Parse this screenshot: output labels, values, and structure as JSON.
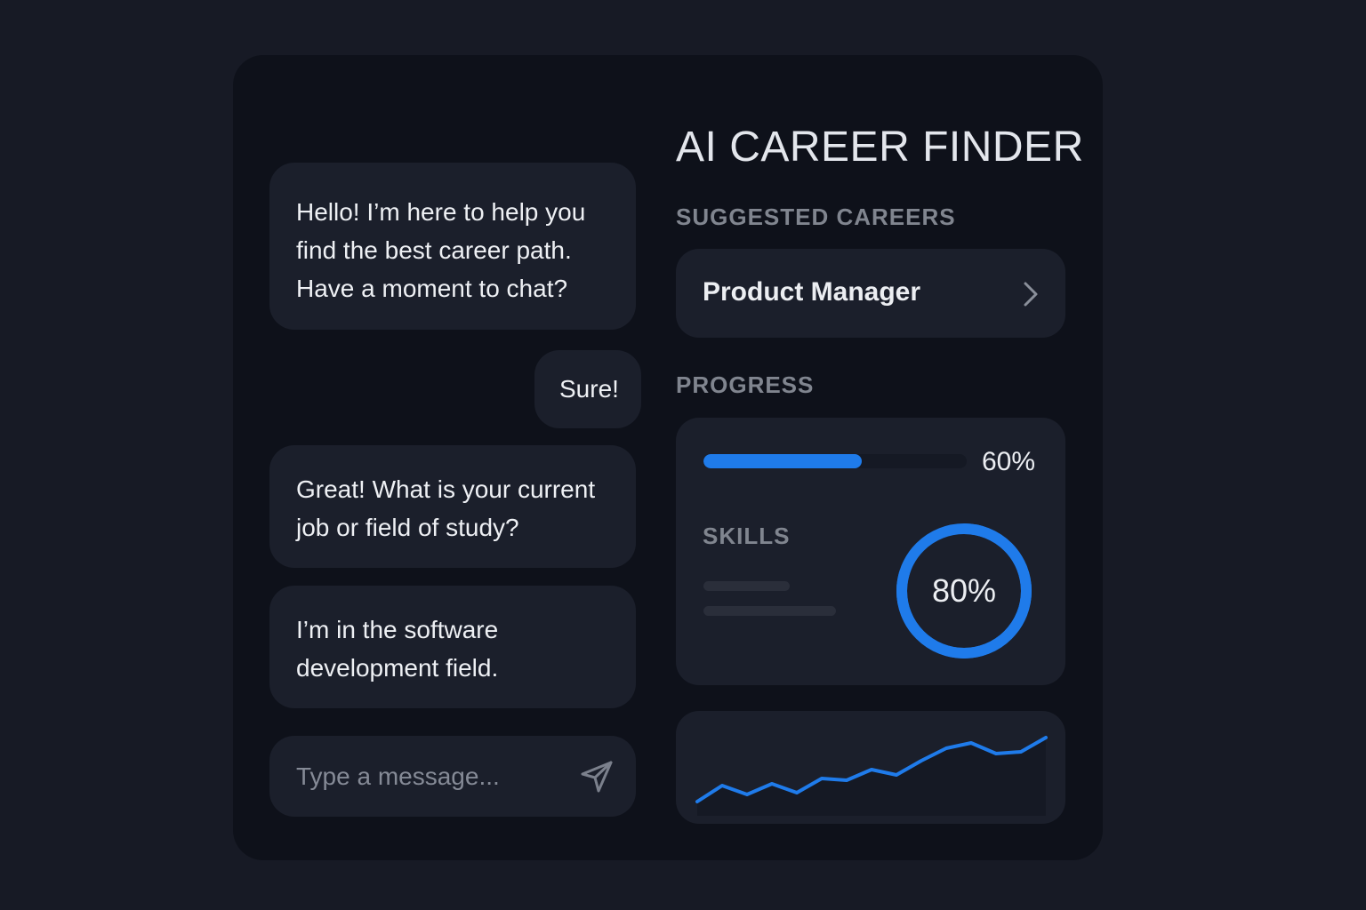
{
  "app": {
    "title": "AI CAREER FINDER"
  },
  "chat": {
    "messages": [
      {
        "sender": "assistant",
        "text": "Hello! I’m here to help you\nfind the best career path.\nHave a moment to chat?"
      },
      {
        "sender": "user",
        "text": "Sure!"
      },
      {
        "sender": "assistant",
        "text": "Great! What is your current\njob or field of study?"
      },
      {
        "sender": "user",
        "text": "I’m in the software\ndevelopment field."
      }
    ],
    "composer": {
      "placeholder": "Type a message...",
      "value": "",
      "send_icon": "send-icon"
    }
  },
  "suggested": {
    "label": "SUGGESTED CAREERS",
    "careers": [
      {
        "name": "Product Manager",
        "icon": "chevron-right-icon"
      }
    ]
  },
  "progress": {
    "label": "PROGRESS",
    "value": 0.6,
    "value_text": "60%",
    "skills": {
      "label": "SKILLS",
      "value": 0.8,
      "value_text": "80%"
    }
  },
  "colors": {
    "accent": "#1f7bea",
    "background": "#171a25",
    "panel": "#0e111a",
    "card": "#1b1f2b",
    "text": "#eceef2",
    "muted": "#80858f"
  },
  "chart_data": {
    "type": "line",
    "title": "",
    "xlabel": "",
    "ylabel": "",
    "grid": false,
    "x": [
      1,
      2,
      3,
      4,
      5,
      6,
      7,
      8,
      9,
      10,
      11,
      12,
      13,
      14,
      15
    ],
    "series": [
      {
        "values": [
          2,
          11,
          6,
          12,
          7,
          15,
          14,
          20,
          17,
          25,
          32,
          35,
          29,
          30,
          38
        ]
      }
    ],
    "ylim": [
      0,
      40
    ]
  }
}
